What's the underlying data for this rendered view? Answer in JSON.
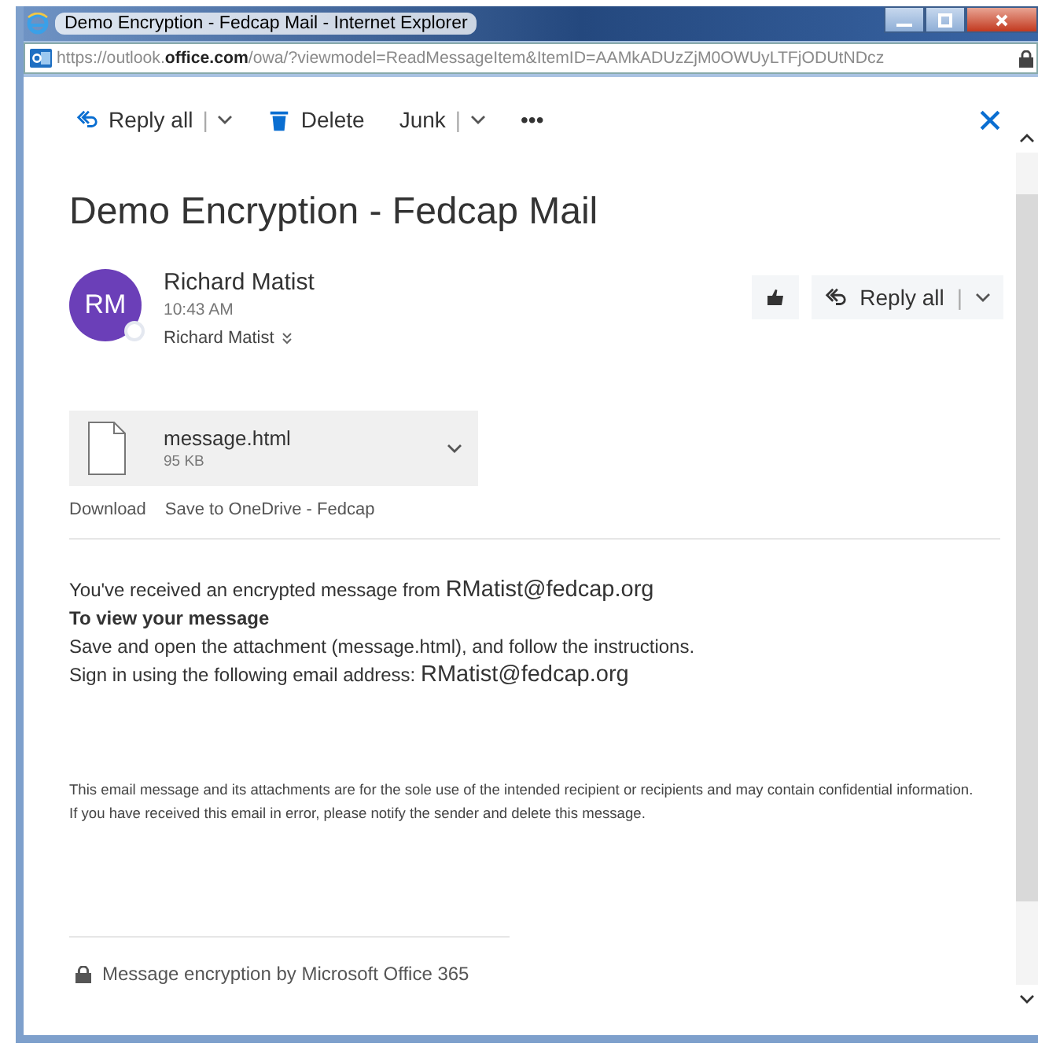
{
  "window": {
    "title": "Demo Encryption - Fedcap Mail - Internet Explorer",
    "address": "https://outlook.**office.com**/owa/?viewmodel=ReadMessageItem&ItemID=AAMkADUzZjM0OWUyLTFjODUtNDcz"
  },
  "toolbar": [
    {
      "kind": "reply",
      "label": "Reply all",
      "separator": "|",
      "dropdown": true
    },
    {
      "kind": "delete",
      "label": "Delete",
      "dropdown": false
    },
    {
      "kind": "plain",
      "label": "Junk",
      "separator": "|",
      "dropdown": true
    },
    {
      "kind": "plain",
      "label": "•••",
      "dropdown": false
    }
  ],
  "subject": "Demo Encryption - Fedcap Mail",
  "sender": {
    "initials": "RM",
    "name": "Richard Matist",
    "time": "10:43 AM",
    "recipient": "Richard Matist"
  },
  "reply_button": {
    "label": "Reply all",
    "separator": "|"
  },
  "attachment": {
    "name": "message.html",
    "size": "95 KB",
    "links": [
      "Download",
      "Save to OneDrive - Fedcap"
    ]
  },
  "body": [
    {
      "text": "You've received an encrypted message from",
      "email": "RMatist@fedcap.org",
      "bold": false
    },
    {
      "text": "To view your message",
      "bold": true
    },
    {
      "text": "Save and open the attachment (message.html), and follow the instructions.",
      "bold": false
    },
    {
      "text": "Sign in using the following email address:",
      "email": "RMatist@fedcap.org",
      "bold": false
    }
  ],
  "disclaimer": "This email message and its attachments are for the sole use of the intended recipient or recipients and may contain confidential information. If you have received this email in error, please notify the sender and delete this message.",
  "footer": "Message encryption by Microsoft Office 365"
}
